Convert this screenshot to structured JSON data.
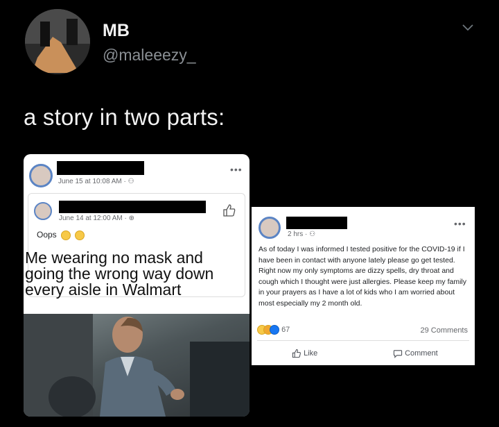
{
  "header": {
    "name": "MB",
    "handle": "@maleeezy_",
    "tweet_text": "a story in two parts:"
  },
  "left_post": {
    "timestamp": "June 15 at 10:08 AM · ⚇",
    "shared": {
      "timestamp": "June 14 at 12:00 AM · ⊕",
      "text": "Oops"
    },
    "meme_lines": [
      "Me wearing no mask and",
      "going the wrong way down",
      "every aisle in Walmart"
    ]
  },
  "right_post": {
    "timestamp": "2 hrs · ⚇",
    "body": "As of today I was informed I tested positive for the COVID-19 if I have been in contact with anyone lately please go get tested. Right now my only symptoms are dizzy spells, dry throat and cough which I thought were just allergies. Please keep my family in your prayers as I have a lot of kids who I am worried about most especially my 2 month old.",
    "reaction_count": "67",
    "comments": "29 Comments",
    "like_label": "Like",
    "comment_label": "Comment"
  },
  "colors": {
    "background": "#000000",
    "fb_blue_ring": "#5b84c4"
  }
}
